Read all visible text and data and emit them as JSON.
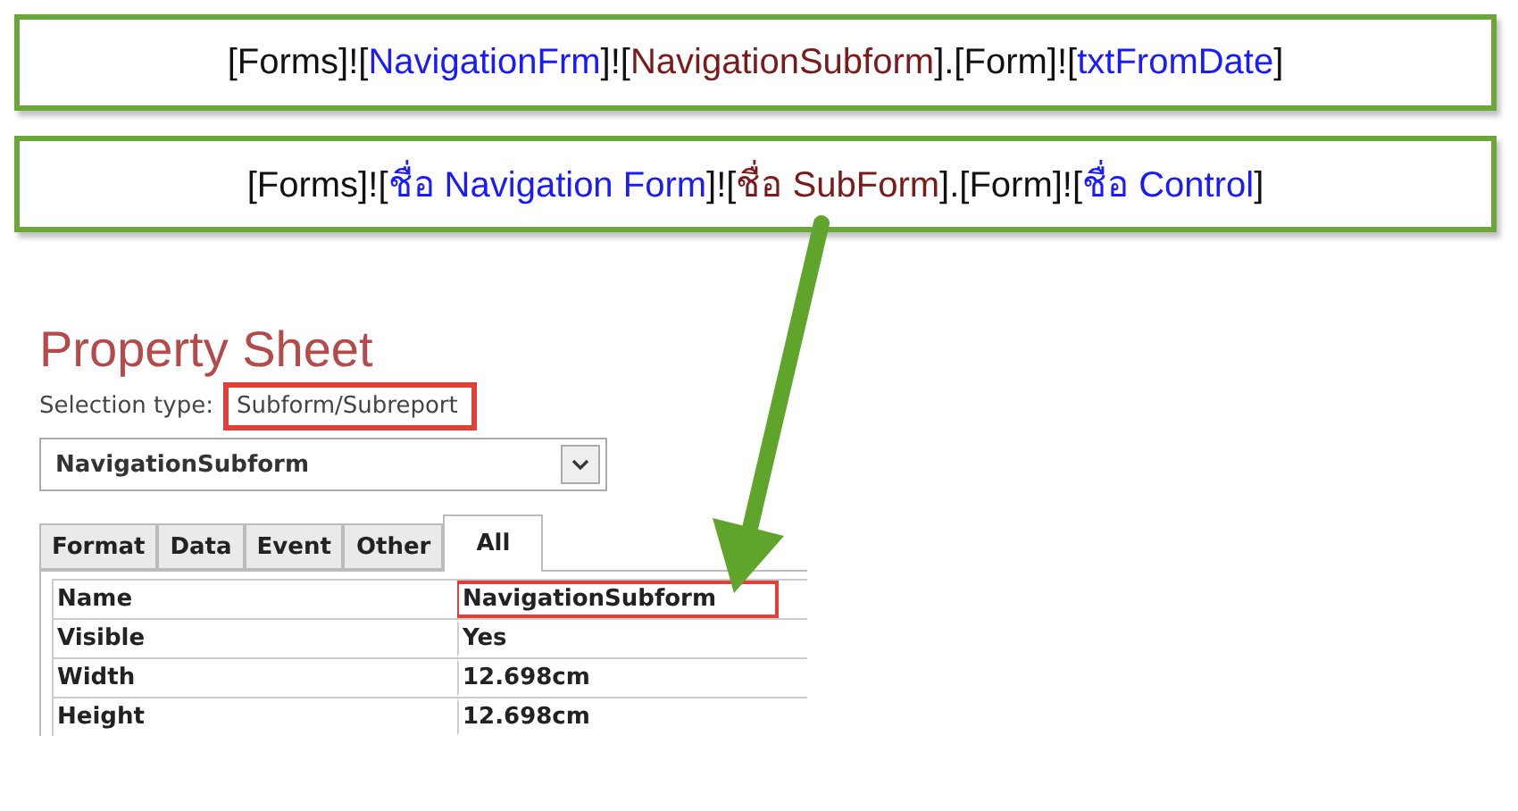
{
  "formulas": [
    {
      "segments": [
        {
          "text": "[Forms]!",
          "color": "#111111"
        },
        {
          "text": "[",
          "color": "#111111"
        },
        {
          "text": "NavigationFrm",
          "color": "#1a1aff"
        },
        {
          "text": "]!",
          "color": "#111111"
        },
        {
          "text": "[",
          "color": "#111111"
        },
        {
          "text": "NavigationSubform",
          "color": "#7a1a1a"
        },
        {
          "text": "].[Form]!",
          "color": "#111111"
        },
        {
          "text": "[",
          "color": "#111111"
        },
        {
          "text": "txtFromDate",
          "color": "#1a1aff"
        },
        {
          "text": "]",
          "color": "#111111"
        }
      ]
    },
    {
      "segments": [
        {
          "text": "[Forms]!",
          "color": "#111111"
        },
        {
          "text": "[",
          "color": "#111111"
        },
        {
          "text": "ชื่อ Navigation Form",
          "color": "#1a1aff"
        },
        {
          "text": "]!",
          "color": "#111111"
        },
        {
          "text": "[",
          "color": "#111111"
        },
        {
          "text": "ชื่อ SubForm",
          "color": "#7a1a1a"
        },
        {
          "text": "].[Form]!",
          "color": "#111111"
        },
        {
          "text": "[",
          "color": "#111111"
        },
        {
          "text": "ชื่อ Control",
          "color": "#1a1aff"
        },
        {
          "text": "]",
          "color": "#111111"
        }
      ]
    }
  ],
  "property_sheet": {
    "title": "Property Sheet",
    "selection_label": "Selection type:",
    "selection_value": {
      "text": "Subform/Subreport",
      "highlighted": true
    },
    "object_dropdown": {
      "value": "NavigationSubform"
    },
    "tabs": [
      {
        "label": "Format",
        "selected": false
      },
      {
        "label": "Data",
        "selected": false
      },
      {
        "label": "Event",
        "selected": false
      },
      {
        "label": "Other",
        "selected": false
      },
      {
        "label": "All",
        "selected": true
      }
    ],
    "rows": [
      {
        "name": "Name",
        "value": "NavigationSubform",
        "highlighted": true
      },
      {
        "name": "Visible",
        "value": "Yes",
        "highlighted": false
      },
      {
        "name": "Width",
        "value": "12.698cm",
        "highlighted": false
      },
      {
        "name": "Height",
        "value": "12.698cm",
        "highlighted": false
      }
    ]
  }
}
